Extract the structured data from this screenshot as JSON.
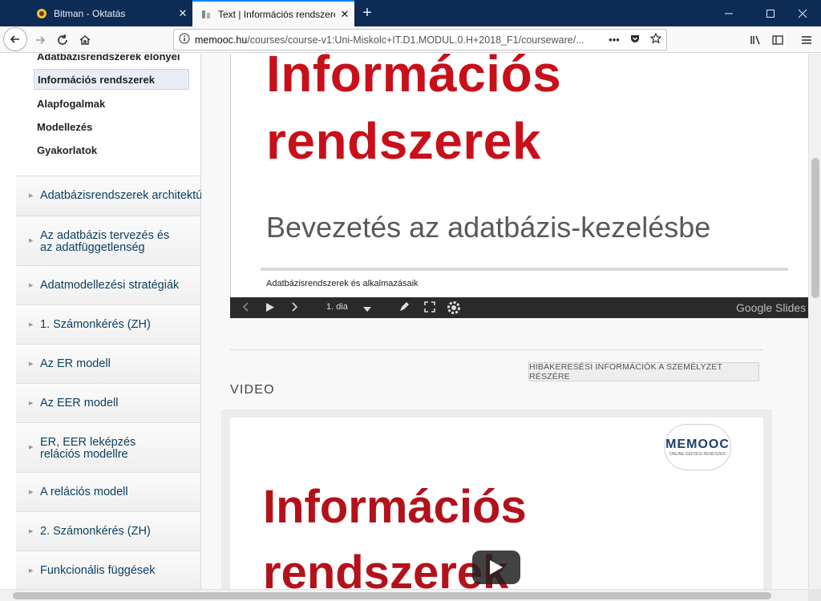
{
  "browser": {
    "tabs": [
      {
        "title": "Bitman - Oktatás",
        "close": "✕"
      },
      {
        "title": "Text | Információs rendszerek | Ba",
        "close": "✕"
      }
    ],
    "new_tab": "+",
    "url_host": "memooc.hu",
    "url_path": "/courses/course-v1:Uni-Miskolc+IT.D1.MODUL.0.H+2018_F1/courseware/...",
    "more": "•••"
  },
  "sidebar": {
    "sub_items": [
      {
        "label": "Adatbázisrendszerek előnyei"
      },
      {
        "label": "Információs rendszerek",
        "active": true
      },
      {
        "label": "Alapfogalmak"
      },
      {
        "label": "Modellezés"
      },
      {
        "label": "Gyakorlatok"
      }
    ],
    "chapters": [
      {
        "label": "Adatbázisrendszerek architektúrái"
      },
      {
        "label": "Az adatbázis tervezés és az adatfüggetlenség"
      },
      {
        "label": "Adatmodellezési stratégiák"
      },
      {
        "label": "1. Számonkérés (ZH)"
      },
      {
        "label": "Az ER modell"
      },
      {
        "label": "Az EER modell"
      },
      {
        "label": "ER, EER leképzés relációs modellre"
      },
      {
        "label": "A relációs modell"
      },
      {
        "label": "2. Számonkérés (ZH)"
      },
      {
        "label": "Funkcionális függések"
      }
    ]
  },
  "slides": {
    "title_line1": "Információs",
    "title_line2": "rendszerek",
    "subtitle": "Bevezetés az adatbázis-kezelésbe",
    "footer": "Adatbázisrendszerek és alkalmazásaik",
    "page_select": "1. dia",
    "brand": "Google Slides"
  },
  "staff_button": "HIBAKERESÉSI INFORMÁCIÓK A SZEMÉLYZET RÉSZÉRE",
  "video": {
    "heading": "VIDEO",
    "title_line1": "Információs",
    "title_line2": "rendszerek",
    "logo_text": "MEMOOC",
    "logo_tag": "ONLINE KÉPZÉSI RENDSZER"
  }
}
